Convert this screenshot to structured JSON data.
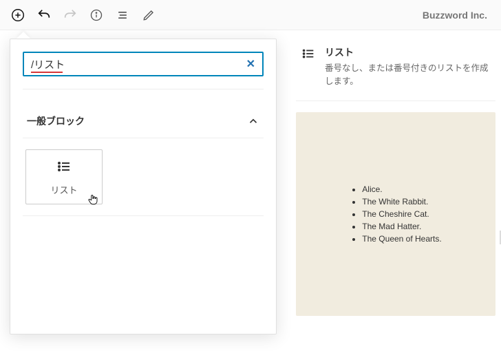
{
  "brand": "Buzzword Inc.",
  "toolbar": {
    "add": "add-block",
    "undo": "undo",
    "redo": "redo",
    "info": "content-info",
    "outline": "outline",
    "edit": "edit"
  },
  "inserter": {
    "search_value": "/リスト",
    "section_title": "一般ブロック",
    "block": {
      "label": "リスト",
      "icon": "list-icon"
    }
  },
  "details": {
    "title": "リスト",
    "description": "番号なし、または番号付きのリストを作成します。",
    "preview_items": [
      "Alice.",
      "The White Rabbit.",
      "The Cheshire Cat.",
      "The Mad Hatter.",
      "The Queen of Hearts."
    ]
  }
}
